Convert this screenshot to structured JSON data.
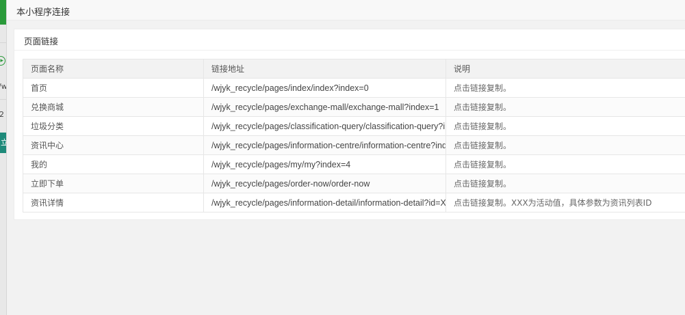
{
  "background_app": {
    "w_text": "/w",
    "two_text": "2",
    "teal_text": "立"
  },
  "modal": {
    "title": "本小程序连接"
  },
  "card": {
    "title": "页面链接"
  },
  "table": {
    "headers": [
      "页面名称",
      "链接地址",
      "说明"
    ],
    "rows": [
      {
        "name": "首页",
        "link": "/wjyk_recycle/pages/index/index?index=0",
        "note": "点击链接复制。"
      },
      {
        "name": "兑换商城",
        "link": "/wjyk_recycle/pages/exchange-mall/exchange-mall?index=1",
        "note": "点击链接复制。"
      },
      {
        "name": "垃圾分类",
        "link": "/wjyk_recycle/pages/classification-query/classification-query?ir",
        "note": "点击链接复制。"
      },
      {
        "name": "资讯中心",
        "link": "/wjyk_recycle/pages/information-centre/information-centre?ind",
        "note": "点击链接复制。"
      },
      {
        "name": "我的",
        "link": "/wjyk_recycle/pages/my/my?index=4",
        "note": "点击链接复制。"
      },
      {
        "name": "立即下单",
        "link": "/wjyk_recycle/pages/order-now/order-now",
        "note": "点击链接复制。"
      },
      {
        "name": "资讯详情",
        "link": "/wjyk_recycle/pages/information-detail/information-detail?id=X",
        "note": "点击链接复制。XXX为活动值，具体参数为资讯列表ID"
      }
    ]
  },
  "colors": {
    "bg_green": "#2a9a3a",
    "bg_teal": "#1e8a7a",
    "modal_bg": "#f2f2f2",
    "header_bg": "#f2f2f2"
  }
}
